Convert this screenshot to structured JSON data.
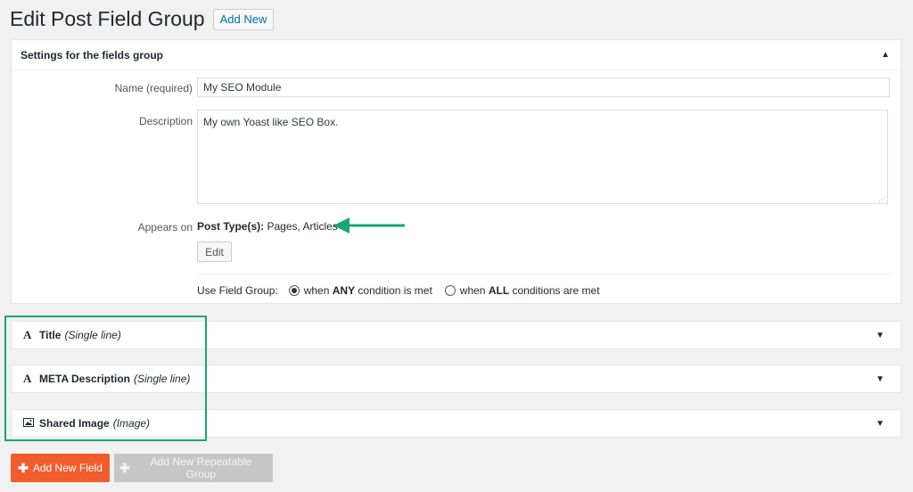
{
  "header": {
    "title": "Edit Post Field Group",
    "add_new": "Add New"
  },
  "settings": {
    "title": "Settings for the fields group",
    "name_label": "Name (required)",
    "name_value": "My SEO Module",
    "description_label": "Description",
    "description_value": "My own Yoast like SEO Box.",
    "appears_label": "Appears on",
    "appears_key": "Post Type(s):",
    "appears_value": "Pages, Articles",
    "edit_label": "Edit",
    "use_label": "Use Field Group:",
    "option_any_pre": "when",
    "option_any_bold": "ANY",
    "option_any_post": "condition is met",
    "option_all_pre": "when",
    "option_all_bold": "ALL",
    "option_all_post": "conditions are met",
    "selected_option": "any"
  },
  "fields": [
    {
      "name": "Title",
      "type": "(Single line)",
      "icon": "text-icon"
    },
    {
      "name": "META Description",
      "type": "(Single line)",
      "icon": "text-icon"
    },
    {
      "name": "Shared Image",
      "type": "(Image)",
      "icon": "image-icon"
    }
  ],
  "buttons": {
    "add_field": "Add New Field",
    "add_repeatable": "Add New Repeatable Group"
  },
  "colors": {
    "accent_orange": "#f05c2c",
    "highlight_green": "#17a673",
    "link_blue": "#0073aa"
  }
}
